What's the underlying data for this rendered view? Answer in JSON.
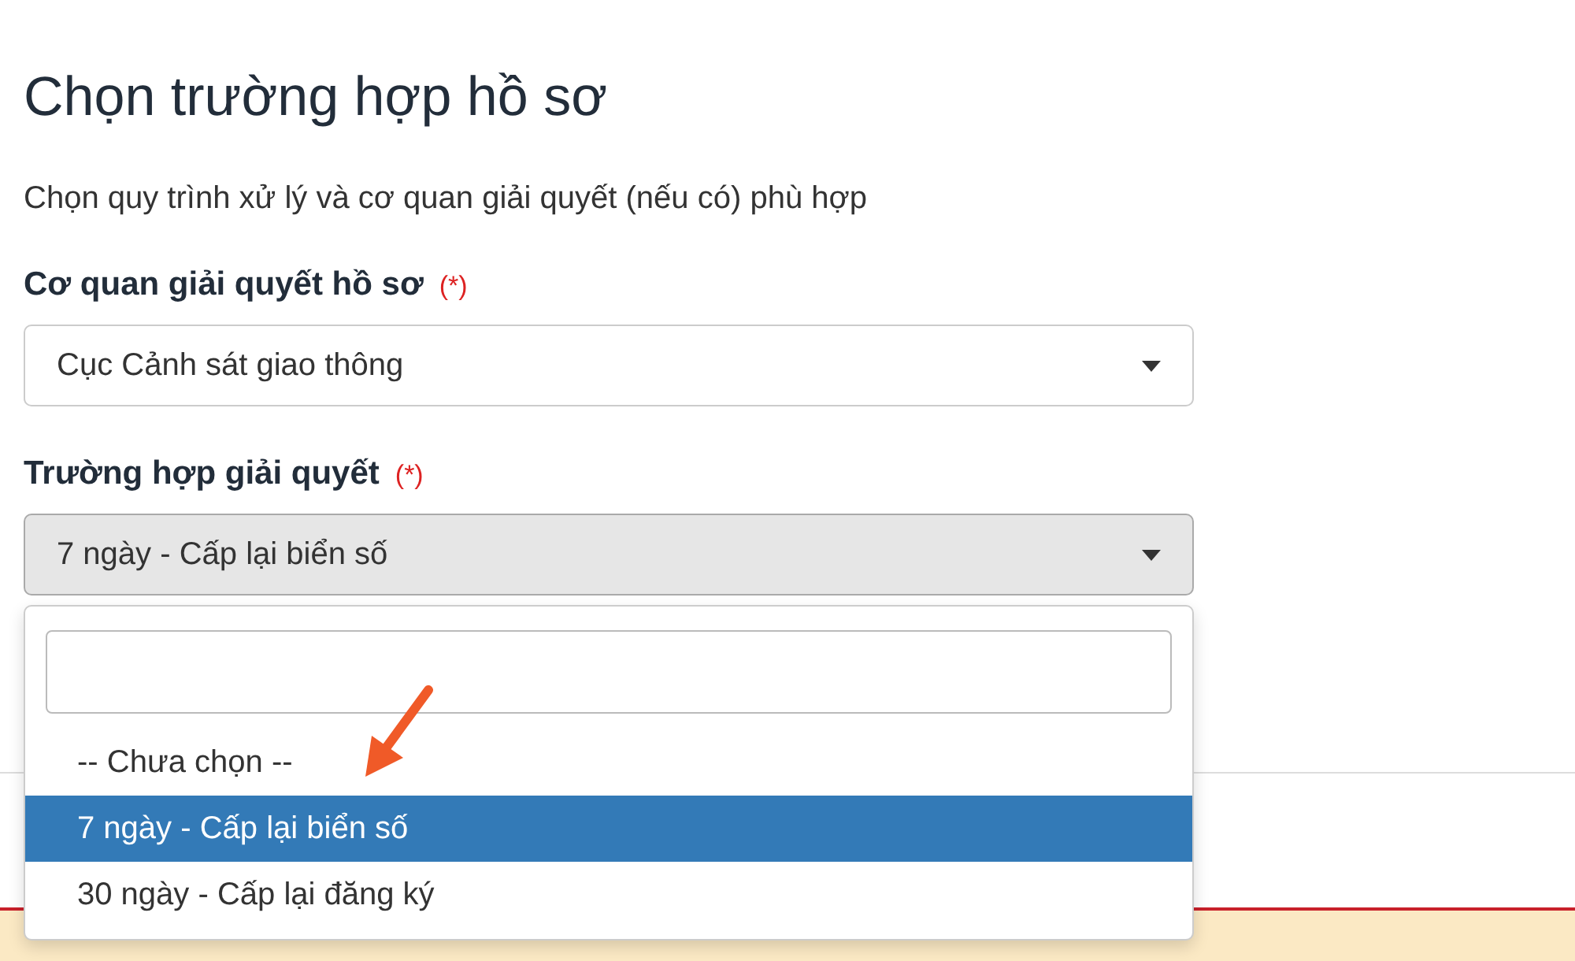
{
  "heading": "Chọn trường hợp hồ sơ",
  "description": "Chọn quy trình xử lý và cơ quan giải quyết (nếu có) phù hợp",
  "fields": [
    {
      "label": "Cơ quan giải quyết hồ sơ",
      "required_mark": "(*)",
      "value": "Cục Cảnh sát giao thông",
      "open": false
    },
    {
      "label": "Trường hợp giải quyết",
      "required_mark": "(*)",
      "value": "7 ngày - Cấp lại biển số",
      "open": true
    }
  ],
  "dropdown": {
    "options": [
      {
        "label": "-- Chưa chọn --",
        "selected": false
      },
      {
        "label": "7 ngày - Cấp lại biển số",
        "selected": true
      },
      {
        "label": "30 ngày - Cấp lại đăng ký",
        "selected": false
      }
    ]
  },
  "annotation": {
    "kind": "arrow"
  }
}
